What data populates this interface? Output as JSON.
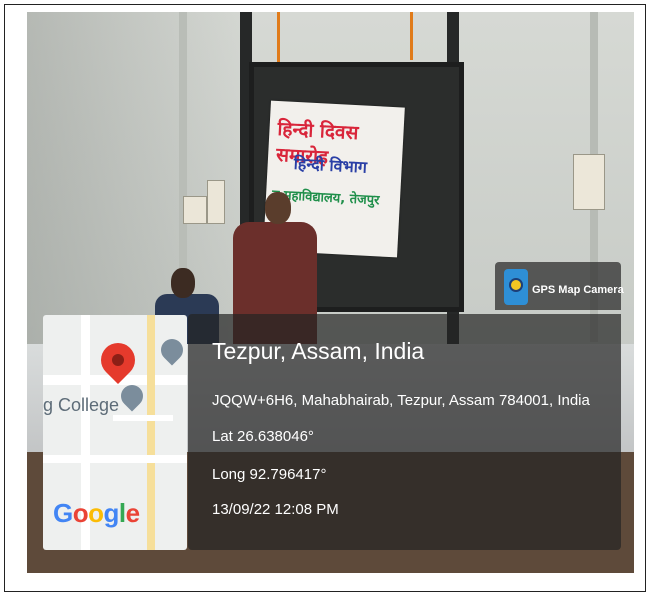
{
  "overlay": {
    "app_badge": "GPS Map Camera",
    "location_title": "Tezpur, Assam, India",
    "address": "JQQW+6H6, Mahabhairab, Tezpur, Assam 784001, India",
    "latitude": "Lat 26.638046°",
    "longitude": "Long 92.796417°",
    "timestamp": "13/09/22 12:08 PM"
  },
  "map": {
    "place_label": "g College",
    "google_logo": [
      "G",
      "o",
      "o",
      "g",
      "l",
      "e"
    ],
    "google_colors": [
      "#4285F4",
      "#EA4335",
      "#FBBC05",
      "#4285F4",
      "#34A853",
      "#EA4335"
    ]
  },
  "banner": {
    "line1": "हिन्दी दिवस समारोह",
    "line2": "हिन्दी विभाग",
    "line3": "न महाविद्यालय, तेजपुर"
  },
  "colors": {
    "overlay_bg": "#232323",
    "pin_red": "#e53a2c",
    "pin_grey": "#7b8d9c",
    "gps_icon": "#2e8fd6"
  }
}
